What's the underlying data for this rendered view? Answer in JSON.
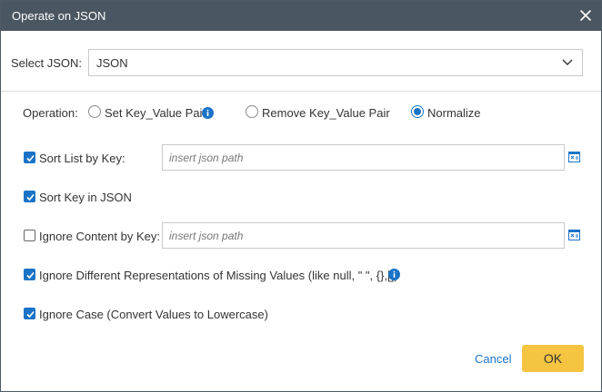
{
  "dialog": {
    "title": "Operate on JSON",
    "close_icon": "close-icon"
  },
  "select_json": {
    "label": "Select JSON:",
    "value": "JSON",
    "icon": "chevron-down-icon"
  },
  "operation": {
    "label": "Operation:",
    "options": [
      {
        "label": "Set Key_Value Pair",
        "checked": false,
        "info_icon": true
      },
      {
        "label": "Remove Key_Value Pair",
        "checked": false,
        "info_icon": false
      },
      {
        "label": "Normalize",
        "checked": true,
        "info_icon": false
      }
    ]
  },
  "options": {
    "sort_list_by_key": {
      "label": "Sort List by Key:",
      "checked": true,
      "input_placeholder": "insert json path",
      "input_value": ""
    },
    "sort_key_in_json": {
      "label": "Sort Key in JSON",
      "checked": true
    },
    "ignore_content_by_key": {
      "label": "Ignore Content by Key:",
      "checked": false,
      "input_placeholder": "insert json path",
      "input_value": ""
    },
    "ignore_missing_values": {
      "label": "Ignore Different Representations of Missing Values (like null, \" \", {},[])",
      "checked": true,
      "info_icon": true
    },
    "ignore_case": {
      "label": "Ignore Case (Convert Values to Lowercase)",
      "checked": true
    }
  },
  "footer": {
    "cancel_label": "Cancel",
    "ok_label": "OK"
  },
  "colors": {
    "titlebar": "#4a5661",
    "accent": "#1a73c7",
    "ok_button": "#f5c542"
  }
}
